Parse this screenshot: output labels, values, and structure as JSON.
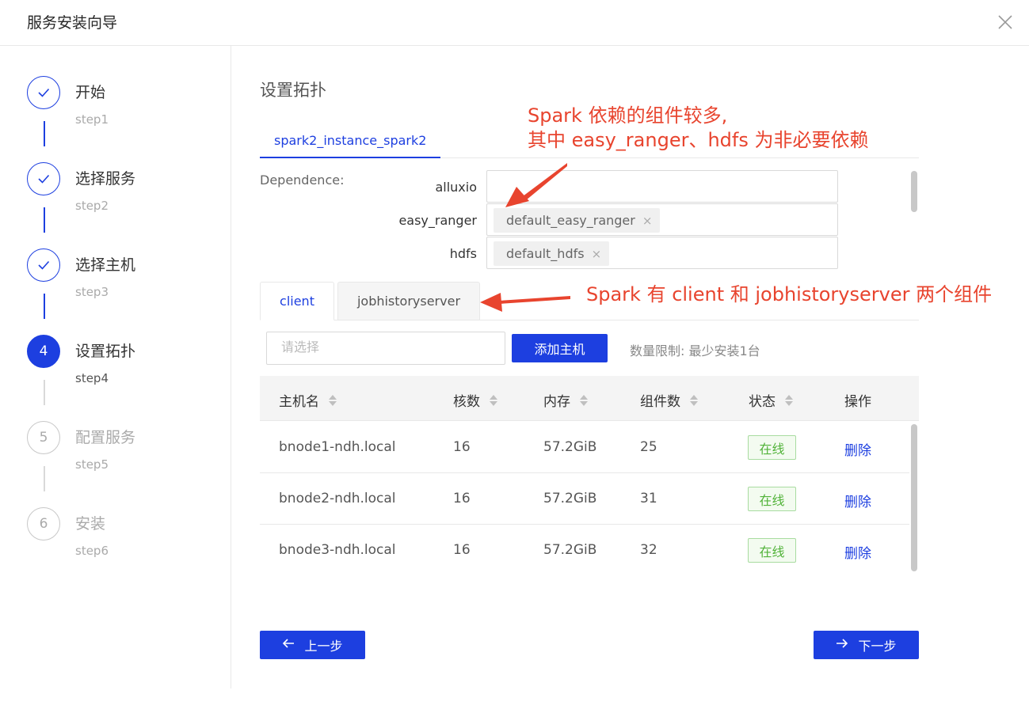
{
  "header": {
    "title": "服务安装向导"
  },
  "steps": [
    {
      "num": "1",
      "title": "开始",
      "sub": "step1",
      "state": "done"
    },
    {
      "num": "2",
      "title": "选择服务",
      "sub": "step2",
      "state": "done"
    },
    {
      "num": "3",
      "title": "选择主机",
      "sub": "step3",
      "state": "done"
    },
    {
      "num": "4",
      "title": "设置拓扑",
      "sub": "step4",
      "state": "active"
    },
    {
      "num": "5",
      "title": "配置服务",
      "sub": "step5",
      "state": "pending"
    },
    {
      "num": "6",
      "title": "安装",
      "sub": "step6",
      "state": "pending"
    }
  ],
  "main": {
    "title": "设置拓扑",
    "instance_tab": "spark2_instance_spark2",
    "dependence_label": "Dependence:",
    "dependencies": [
      {
        "name": "alluxio",
        "tags": []
      },
      {
        "name": "easy_ranger",
        "tags": [
          "default_easy_ranger"
        ]
      },
      {
        "name": "hdfs",
        "tags": [
          "default_hdfs"
        ]
      }
    ],
    "component_tabs": [
      {
        "label": "client",
        "active": true
      },
      {
        "label": "jobhistoryserver",
        "active": false
      }
    ],
    "host_select_placeholder": "请选择",
    "add_host_label": "添加主机",
    "limit_text": "数量限制:  最少安装1台",
    "columns": [
      "主机名",
      "核数",
      "内存",
      "组件数",
      "状态",
      "操作"
    ],
    "rows": [
      {
        "host": "bnode1-ndh.local",
        "cores": "16",
        "memory": "57.2GiB",
        "components": "25",
        "status": "在线",
        "action": "删除"
      },
      {
        "host": "bnode2-ndh.local",
        "cores": "16",
        "memory": "57.2GiB",
        "components": "31",
        "status": "在线",
        "action": "删除"
      },
      {
        "host": "bnode3-ndh.local",
        "cores": "16",
        "memory": "57.2GiB",
        "components": "32",
        "status": "在线",
        "action": "删除"
      }
    ],
    "prev_label": "上一步",
    "next_label": "下一步"
  },
  "annotations": {
    "deps_line1": "Spark 依赖的组件较多,",
    "deps_line2": "其中 easy_ranger、hdfs 为非必要依赖",
    "components": "Spark 有 client 和 jobhistoryserver 两个组件"
  },
  "colors": {
    "accent": "#1d3fe0",
    "online": "#52b33a",
    "annotation": "#e8442e"
  }
}
